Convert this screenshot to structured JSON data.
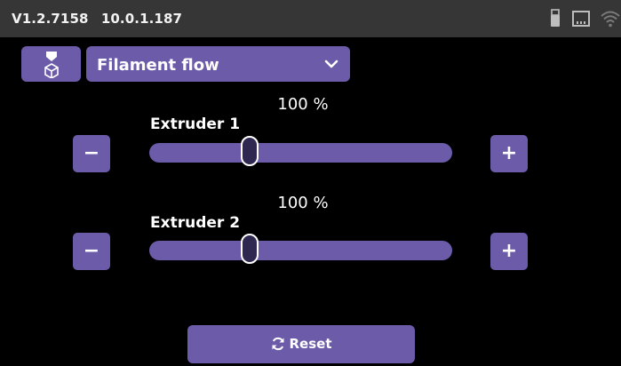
{
  "status_bar": {
    "version": "V1.2.7158",
    "ip": "10.0.1.187",
    "icons": [
      "usb-icon",
      "ethernet-icon",
      "wifi-icon"
    ]
  },
  "header": {
    "mode_icon": "filament-spool-icon",
    "dropdown_value": "Filament flow",
    "dropdown_icon": "chevron-down-icon"
  },
  "sliders": [
    {
      "label": "Extruder 1",
      "value_text": "100 %",
      "value": 100,
      "fraction": 0.33
    },
    {
      "label": "Extruder 2",
      "value_text": "100 %",
      "value": 100,
      "fraction": 0.33
    }
  ],
  "buttons": {
    "minus": "−",
    "plus": "+"
  },
  "reset": {
    "label": "Reset",
    "icon": "sync-icon"
  },
  "colors": {
    "accent": "#6b5ba8",
    "status_bar": "#363636",
    "thumb": "#2f2850",
    "background": "#000000"
  }
}
